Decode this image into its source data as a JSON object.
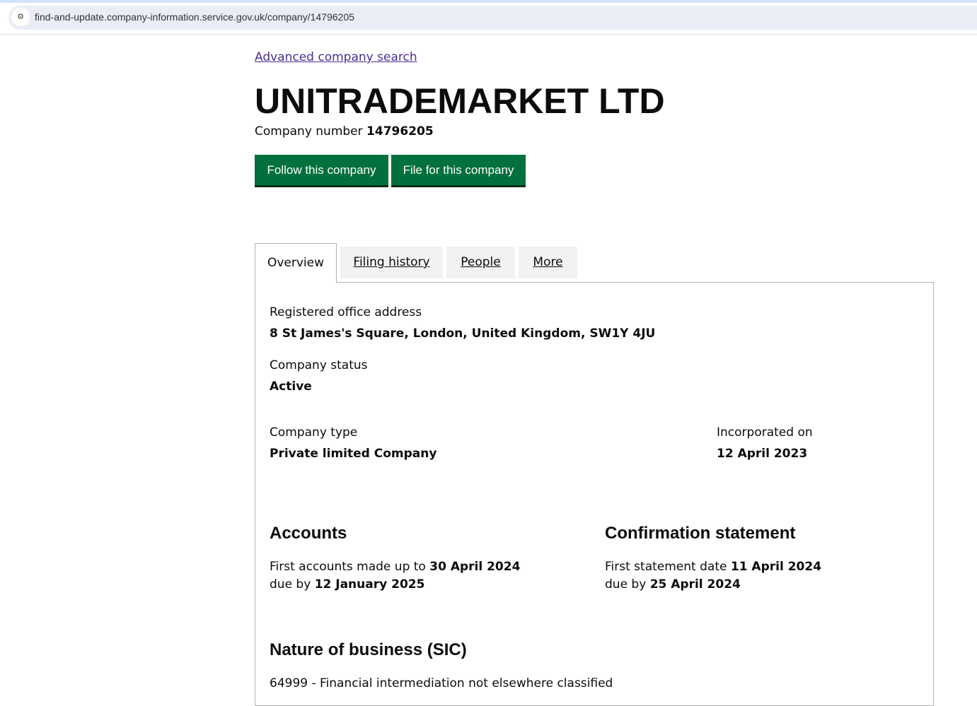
{
  "browser": {
    "url": "find-and-update.company-information.service.gov.uk/company/14796205",
    "site_info_icon": "tune-icon"
  },
  "links": {
    "advanced_search": "Advanced company search"
  },
  "company": {
    "name": "UNITRADEMARKET LTD",
    "number_label": "Company number",
    "number": "14796205"
  },
  "buttons": {
    "follow": "Follow this company",
    "file": "File for this company"
  },
  "tabs": [
    {
      "label": "Overview",
      "active": true
    },
    {
      "label": "Filing history"
    },
    {
      "label": "People"
    },
    {
      "label": "More"
    }
  ],
  "overview": {
    "address_label": "Registered office address",
    "address": "8 St James's Square, London, United Kingdom, SW1Y 4JU",
    "status_label": "Company status",
    "status": "Active",
    "type_label": "Company type",
    "type": "Private limited Company",
    "incorporated_label": "Incorporated on",
    "incorporated": "12 April 2023",
    "accounts": {
      "heading": "Accounts",
      "line1_text": "First accounts made up to",
      "line1_date": "30 April 2024",
      "line2_text": "due by",
      "line2_date": "12 January 2025"
    },
    "confirmation": {
      "heading": "Confirmation statement",
      "line1_text": "First statement date",
      "line1_date": "11 April 2024",
      "line2_text": "due by",
      "line2_date": "25 April 2024"
    },
    "sic": {
      "heading": "Nature of business (SIC)",
      "item": "64999 - Financial intermediation not elsewhere classified"
    }
  },
  "colors": {
    "button": "#00703c",
    "link": "#4c2c92"
  }
}
